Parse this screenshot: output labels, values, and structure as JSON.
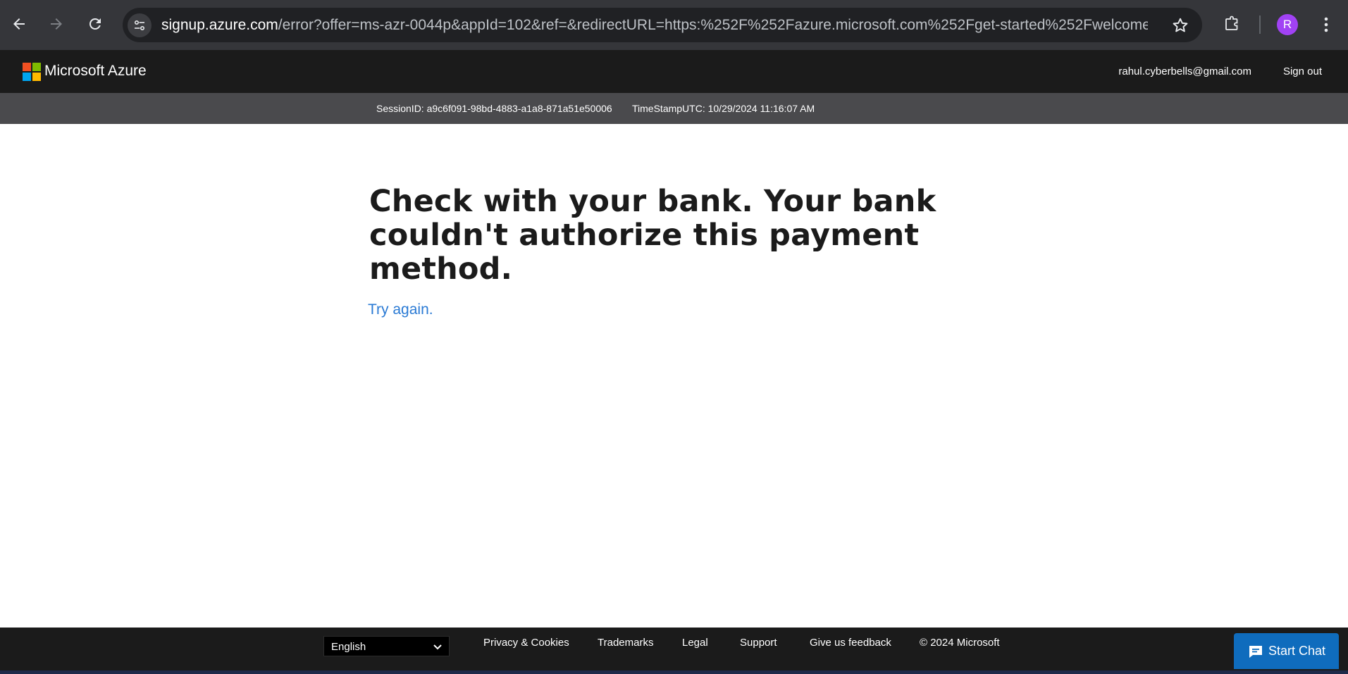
{
  "browser": {
    "url_host": "signup.azure.com",
    "url_path": "/error?offer=ms-azr-0044p&appId=102&ref=&redirectURL=https:%252F%252Fazure.microsoft.com%252Fget-started%252Fwelcome...",
    "profile_initial": "R"
  },
  "header": {
    "brand": "Microsoft Azure",
    "user_email": "rahul.cyberbells@gmail.com",
    "sign_out": "Sign out"
  },
  "session": {
    "session_id": "SessionID: a9c6f091-98bd-4883-a1a8-871a51e50006",
    "timestamp": "TimeStampUTC: 10/29/2024 11:16:07 AM"
  },
  "main": {
    "headline": "Check with your bank. Your bank couldn't authorize this payment method.",
    "try_again": "Try again."
  },
  "footer": {
    "language": "English",
    "links": [
      "Privacy & Cookies",
      "Trademarks",
      "Legal",
      "Support",
      "Give us feedback",
      "© 2024 Microsoft"
    ],
    "start_chat": "Start Chat"
  },
  "colors": {
    "ms_red": "#f25022",
    "ms_green": "#7fba00",
    "ms_blue": "#00a4ef",
    "ms_yellow": "#ffb900",
    "link_blue": "#2a7ad4",
    "chat_blue": "#0f6cbd"
  },
  "icons": [
    "back-arrow-icon",
    "forward-arrow-icon",
    "reload-icon",
    "site-info-icon",
    "star-icon",
    "extensions-icon",
    "kebab-menu-icon",
    "microsoft-logo",
    "chevron-down-icon",
    "chat-icon"
  ]
}
